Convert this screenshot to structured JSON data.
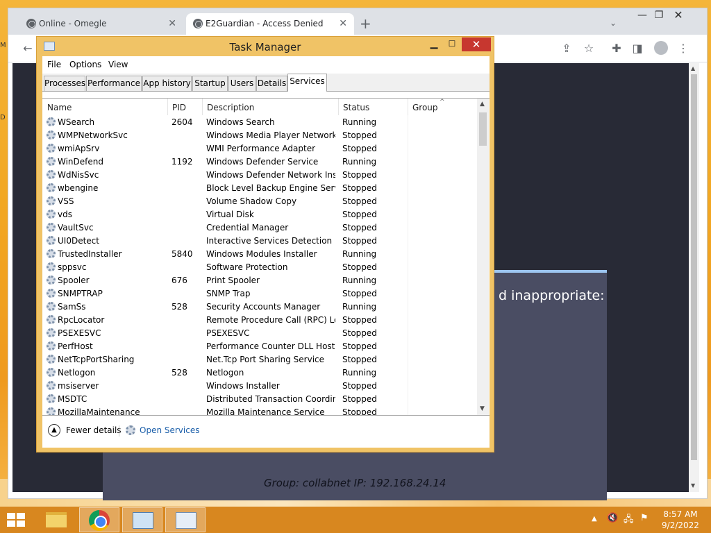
{
  "browser": {
    "tabs": [
      {
        "title": "Online - Omegle",
        "active": false
      },
      {
        "title": "E2Guardian - Access Denied",
        "active": true
      }
    ],
    "page": {
      "heading_fragment": "d inappropriate:",
      "group_line": "Group: collabnet   IP: 192.168.24.14"
    }
  },
  "task_manager": {
    "title": "Task Manager",
    "menu": [
      "File",
      "Options",
      "View"
    ],
    "tabs": [
      "Processes",
      "Performance",
      "App history",
      "Startup",
      "Users",
      "Details",
      "Services"
    ],
    "selected_tab": "Services",
    "columns": {
      "name": "Name",
      "pid": "PID",
      "description": "Description",
      "status": "Status",
      "group": "Group"
    },
    "services": [
      {
        "name": "WSearch",
        "pid": "2604",
        "description": "Windows Search",
        "status": "Running"
      },
      {
        "name": "WMPNetworkSvc",
        "pid": "",
        "description": "Windows Media Player Network ...",
        "status": "Stopped"
      },
      {
        "name": "wmiApSrv",
        "pid": "",
        "description": "WMI Performance Adapter",
        "status": "Stopped"
      },
      {
        "name": "WinDefend",
        "pid": "1192",
        "description": "Windows Defender Service",
        "status": "Running"
      },
      {
        "name": "WdNisSvc",
        "pid": "",
        "description": "Windows Defender Network Insp...",
        "status": "Stopped"
      },
      {
        "name": "wbengine",
        "pid": "",
        "description": "Block Level Backup Engine Service",
        "status": "Stopped"
      },
      {
        "name": "VSS",
        "pid": "",
        "description": "Volume Shadow Copy",
        "status": "Stopped"
      },
      {
        "name": "vds",
        "pid": "",
        "description": "Virtual Disk",
        "status": "Stopped"
      },
      {
        "name": "VaultSvc",
        "pid": "",
        "description": "Credential Manager",
        "status": "Stopped"
      },
      {
        "name": "UI0Detect",
        "pid": "",
        "description": "Interactive Services Detection",
        "status": "Stopped"
      },
      {
        "name": "TrustedInstaller",
        "pid": "5840",
        "description": "Windows Modules Installer",
        "status": "Running"
      },
      {
        "name": "sppsvc",
        "pid": "",
        "description": "Software Protection",
        "status": "Stopped"
      },
      {
        "name": "Spooler",
        "pid": "676",
        "description": "Print Spooler",
        "status": "Running"
      },
      {
        "name": "SNMPTRAP",
        "pid": "",
        "description": "SNMP Trap",
        "status": "Stopped"
      },
      {
        "name": "SamSs",
        "pid": "528",
        "description": "Security Accounts Manager",
        "status": "Running"
      },
      {
        "name": "RpcLocator",
        "pid": "",
        "description": "Remote Procedure Call (RPC) Lo...",
        "status": "Stopped"
      },
      {
        "name": "PSEXESVC",
        "pid": "",
        "description": "PSEXESVC",
        "status": "Stopped"
      },
      {
        "name": "PerfHost",
        "pid": "",
        "description": "Performance Counter DLL Host",
        "status": "Stopped"
      },
      {
        "name": "NetTcpPortSharing",
        "pid": "",
        "description": "Net.Tcp Port Sharing Service",
        "status": "Stopped"
      },
      {
        "name": "Netlogon",
        "pid": "528",
        "description": "Netlogon",
        "status": "Running"
      },
      {
        "name": "msiserver",
        "pid": "",
        "description": "Windows Installer",
        "status": "Stopped"
      },
      {
        "name": "MSDTC",
        "pid": "",
        "description": "Distributed Transaction Coordin...",
        "status": "Stopped"
      },
      {
        "name": "MozillaMaintenance",
        "pid": "",
        "description": "Mozilla Maintenance Service",
        "status": "Stopped"
      }
    ],
    "footer": {
      "fewer_details": "Fewer details",
      "open_services": "Open Services"
    }
  },
  "taskbar": {
    "time": "8:57 AM",
    "date": "9/2/2022"
  },
  "colors": {
    "wallpaper": "#f2a722",
    "taskbar": "#d8871f",
    "close_button": "#c7372f",
    "page_background": "#282a36",
    "link": "#1a5ea9"
  }
}
